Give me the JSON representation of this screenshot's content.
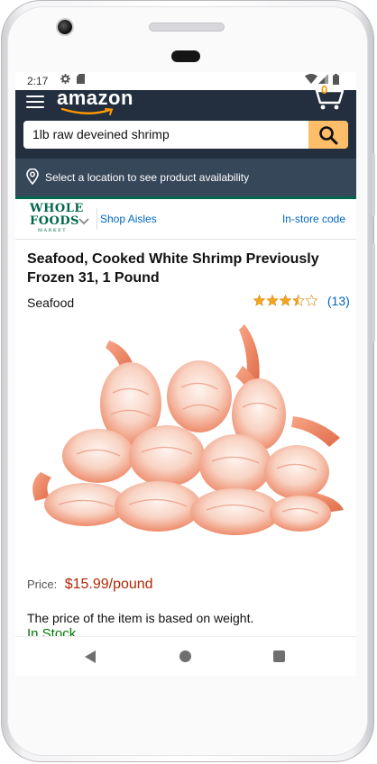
{
  "statusbar": {
    "time": "2:17",
    "icons": [
      "gear-icon",
      "sd-card-icon",
      "wifi-icon",
      "signal-icon",
      "battery-icon"
    ]
  },
  "header": {
    "logo": "amazon",
    "cart_count": "0",
    "brand_color": "#232f3e",
    "accent_color": "#febd69"
  },
  "search": {
    "value": "1lb raw deveined shrimp",
    "placeholder": ""
  },
  "location": {
    "text": "Select a location to see product availability"
  },
  "whole_foods": {
    "logo_line1": "WHOLE",
    "logo_line2": "FOODS",
    "logo_line3": "MARKET",
    "shop_aisles": "Shop Aisles",
    "instore_code": "In-store code",
    "brand_color": "#00674b"
  },
  "product": {
    "title": "Seafood, Cooked White Shrimp Previously Frozen 31, 1 Pound",
    "category": "Seafood",
    "rating": 3.5,
    "rating_max": 5,
    "review_count": "(13)",
    "price_label": "Price:",
    "price": "$15.99/pound",
    "weight_note": "The price of the item is based on weight.",
    "stock": "In Stock",
    "price_color": "#b12704",
    "stock_color": "#007600"
  },
  "navbar": {
    "icons": [
      "back-icon",
      "home-icon",
      "recents-icon"
    ]
  }
}
